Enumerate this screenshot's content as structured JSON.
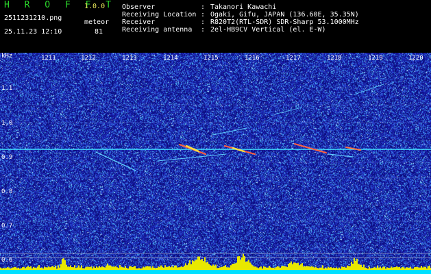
{
  "header": {
    "app_name": "H R O F F T",
    "version": "1.0.0",
    "filename": "2511231210.png",
    "datetime": "25.11.23 12:10",
    "meteor_label": "meteor",
    "meteor_count": "81"
  },
  "info": [
    {
      "key": "Observer",
      "sep": ":",
      "value": "Takanori Kawachi"
    },
    {
      "key": "Receiving Location",
      "sep": ":",
      "value": "Ogaki, Gifu, JAPAN (136.60E, 35.35N)"
    },
    {
      "key": "Receiver",
      "sep": ":",
      "value": "R820T2(RTL-SDR) SDR-Sharp 53.1000MHz"
    },
    {
      "key": "Receiving antenna",
      "sep": ":",
      "value": "2el-HB9CV Vertical (el. E-W)"
    }
  ],
  "axis": {
    "unit": "kHz",
    "time_ticks": [
      "1211",
      "1212",
      "1213",
      "1214",
      "1215",
      "1216",
      "1217",
      "1218",
      "1219",
      "1220"
    ],
    "freq_ticks": [
      "1.1",
      "1.0",
      "0.9",
      "0.8",
      "0.7",
      "0.6"
    ]
  },
  "colors": {
    "background": "#000000",
    "logo": "#2bd62b",
    "version": "#e8e85a",
    "spectrum_bg": "#1818a0",
    "carrier": "#40e0ff",
    "activity_bar": "#e8e800",
    "baseline": "#00e0ff"
  }
}
